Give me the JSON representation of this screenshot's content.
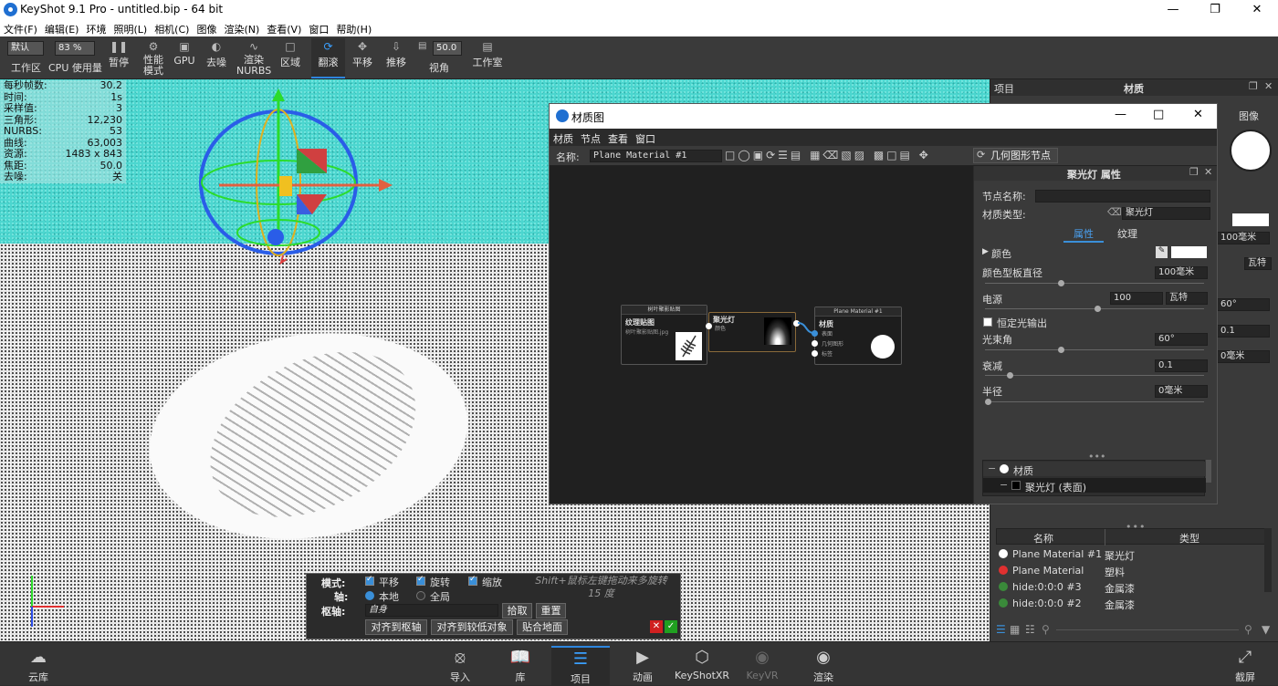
{
  "app": {
    "title": "KeyShot 9.1 Pro  - untitled.bip  - 64 bit"
  },
  "menu": [
    "文件(F)",
    "编辑(E)",
    "环境",
    "照明(L)",
    "相机(C)",
    "图像",
    "渲染(N)",
    "查看(V)",
    "窗口",
    "帮助(H)"
  ],
  "toolbar": {
    "workspace_select": "默认",
    "workspace_label": "工作区",
    "cpu_select": "83 %",
    "cpu_label": "CPU 使用量",
    "pause": "暂停",
    "performance": "性能\n模式",
    "gpu": "GPU",
    "denoise": "去噪",
    "render_nurbs": "渲染\nNURBS",
    "region": "区域",
    "tumble": "翻滚",
    "pan": "平移",
    "dolly": "推移",
    "fov_value": "50.0",
    "fov_label": "视角",
    "studio": "工作室"
  },
  "stats": [
    {
      "k": "每秒帧数:",
      "v": "30.2"
    },
    {
      "k": "时间:",
      "v": "1s"
    },
    {
      "k": "采样值:",
      "v": "3"
    },
    {
      "k": "三角形:",
      "v": "12,230"
    },
    {
      "k": "NURBS:",
      "v": "53"
    },
    {
      "k": "曲线:",
      "v": "63,003"
    },
    {
      "k": "资源:",
      "v": "1483 x 843"
    },
    {
      "k": "焦距:",
      "v": "50.0"
    },
    {
      "k": "去噪:",
      "v": "关"
    }
  ],
  "transform": {
    "mode_label": "模式:",
    "translate": "平移",
    "rotate": "旋转",
    "scale": "缩放",
    "hint": "Shift+鼠标左键拖动来多旋转\n15 度",
    "axis_label": "轴:",
    "local": "本地",
    "global": "全局",
    "pivot_label": "枢轴:",
    "pivot_value": "自身",
    "pick": "拾取",
    "reset": "重置",
    "align_pivot": "对齐到枢轴",
    "align_lower": "对齐到较低对象",
    "snap_ground": "贴合地面"
  },
  "bottombar": [
    "云库",
    "导入",
    "库",
    "项目",
    "动画",
    "KeyShotXR",
    "KeyVR",
    "渲染",
    "截屏"
  ],
  "rightpanel": {
    "head_left": "项目",
    "head_title": "材质",
    "tab_image": "图像",
    "list_headers": [
      "名称",
      "类型"
    ],
    "materials": [
      {
        "name": "Plane Material #1",
        "type": "聚光灯",
        "color": "#ffffff"
      },
      {
        "name": "Plane Material",
        "type": "塑料",
        "color": "#e03030"
      },
      {
        "name": "hide:0:0:0 #3",
        "type": "金属漆",
        "color": "#3a8a3a"
      },
      {
        "name": "hide:0:0:0 #2",
        "type": "金属漆",
        "color": "#3a8a3a"
      }
    ],
    "behind_values": [
      "100毫米",
      "瓦特",
      "60°",
      "0.1",
      "0毫米"
    ]
  },
  "matgraph": {
    "title": "材质图",
    "menu": [
      "材质",
      "节点",
      "查看",
      "窗口"
    ],
    "name_label": "名称:",
    "name_value": "Plane Material #1",
    "geom_node": "几何图形节点",
    "nodes": {
      "tex_header": "树叶聚影贴图",
      "tex_title": "纹理贴图",
      "tex_file": "树叶聚影贴图.jpg",
      "spot_title": "聚光灯",
      "spot_sub": "颜色",
      "mat_header": "Plane Material #1",
      "mat_title": "材质",
      "mat_in1": "表面",
      "mat_in2": "几何图形",
      "mat_in3": "标签"
    },
    "props": {
      "title": "聚光灯  属性",
      "node_name_label": "节点名称:",
      "node_name_value": "",
      "mat_type_label": "材质类型:",
      "mat_type_value": "聚光灯",
      "tab_attr": "属性",
      "tab_texture": "纹理",
      "color_label": "颜色",
      "diameter_label": "颜色型板直径",
      "diameter_value": "100毫米",
      "power_label": "电源",
      "power_value": "100",
      "power_unit": "瓦特",
      "constant_label": "恒定光输出",
      "beam_label": "光束角",
      "beam_value": "60°",
      "falloff_label": "衰减",
      "falloff_value": "0.1",
      "radius_label": "半径",
      "radius_value": "0毫米",
      "tree_root": "材质",
      "tree_child": "聚光灯 (表面)"
    }
  }
}
